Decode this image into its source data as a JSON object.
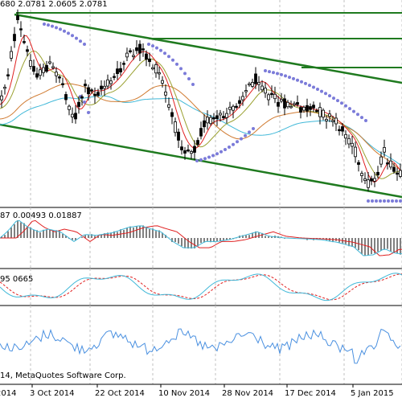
{
  "header": {
    "price_info": "680 2.0781 2.0605 2.0781"
  },
  "macd": {
    "info": "87 0.00493 0.01887"
  },
  "stochastic": {
    "info": "95 0665"
  },
  "footer": {
    "copyright": "14, MetaQuotes Software Corp."
  },
  "colors": {
    "background": "#ffffff",
    "grid": "#c0c0c0",
    "candle": "#000000",
    "trendline": "#1f7a1f",
    "sar": "#7b7bd9",
    "ma_fast": "#e02020",
    "ma_mid": "#9aa030",
    "ma_slow": "#d07a30",
    "ma_slowest": "#40b8d8",
    "macd_signal": "#e02020",
    "macd_main": "#40b8d8",
    "stoch_main": "#40b8d8",
    "stoch_signal": "#e02020",
    "lower_line": "#4a90e0"
  },
  "chart_data": {
    "type": "candlestick",
    "x_labels": [
      "2014",
      "3 Oct 2014",
      "22 Oct 2014",
      "10 Nov 2014",
      "28 Nov 2014",
      "17 Dec 2014",
      "5 Jan 2015"
    ],
    "panels": [
      "price",
      "macd",
      "stochastic",
      "oscillator"
    ]
  }
}
